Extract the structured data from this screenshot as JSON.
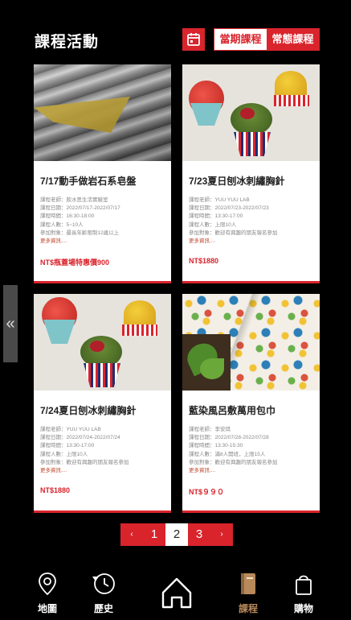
{
  "header": {
    "title": "課程活動",
    "calendar_icon": "calendar-icon",
    "tabs": [
      {
        "label": "當期課程",
        "active": true
      },
      {
        "label": "常態課程",
        "active": false
      }
    ]
  },
  "courses": [
    {
      "title": "7/17動手做岩石系皂盤",
      "info": [
        "課程老師：飲水思生活實驗室",
        "課程日期：2022/07/17-2022/07/17",
        "課程時間：16:30-18:00",
        "課程人數：5~10人",
        "參加對象：最長年齡限制12歲以上"
      ],
      "more": "更多資訊....",
      "price": "NT$瓶蓋場特惠價900"
    },
    {
      "title": "7/23夏日刨冰刺繡胸針",
      "info": [
        "課程老師：YUU YUU LAB",
        "課程日期：2022/07/23-2022/07/23",
        "課程時間：13:30-17:00",
        "課程人數：上限10人",
        "參加對象：歡迎有興趣的朋友報名參加"
      ],
      "more": "更多資訊....",
      "price": "NT$1880"
    },
    {
      "title": "7/24夏日刨冰刺繡胸針",
      "info": [
        "課程老師：YUU YUU LAB",
        "課程日期：2022/07/24-2022/07/24",
        "課程時間：13:30-17:00",
        "課程人數：上限10人",
        "參加對象：歡迎有興趣的朋友報名參加"
      ],
      "more": "更多資訊....",
      "price": "NT$1880"
    },
    {
      "title": "藍染風呂敷萬用包巾",
      "info": [
        "課程老師：李安琪",
        "課程日期：2022/07/28-2022/07/28",
        "課程時間：13:30-15:30",
        "課程人數：滿8人開班，上限15人",
        "參加對象：歡迎有興趣的朋友報名參加"
      ],
      "more": "更多資訊....",
      "price": "NT$９９０"
    }
  ],
  "side_tab": {
    "glyph": "«"
  },
  "pagination": {
    "prev": "‹",
    "pages": [
      "1",
      "2",
      "3"
    ],
    "current": "2",
    "next": "›"
  },
  "bottom_nav": [
    {
      "label": "地圖",
      "icon": "map-pin-icon",
      "active": false
    },
    {
      "label": "歷史",
      "icon": "history-clock-icon",
      "active": false
    },
    {
      "label": "",
      "icon": "home-icon",
      "active": false
    },
    {
      "label": "課程",
      "icon": "book-icon",
      "active": true
    },
    {
      "label": "購物",
      "icon": "shopping-bag-icon",
      "active": false
    }
  ],
  "colors": {
    "accent": "#d9242c",
    "background": "#000000",
    "active_nav": "#b8895a",
    "more_link": "#c14a2e"
  }
}
